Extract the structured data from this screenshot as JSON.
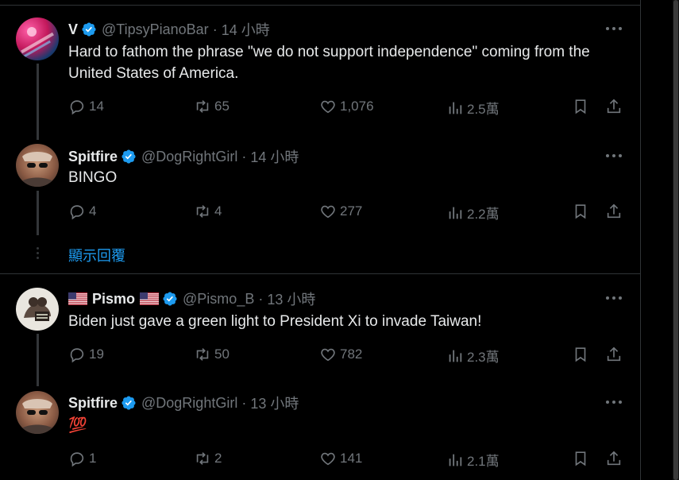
{
  "tweets": [
    {
      "name": "V",
      "handle": "@TipsyPianoBar",
      "time": "14 小時",
      "text": "Hard to fathom the phrase \"we do not support independence\" coming from the United States of America.",
      "replies": "14",
      "retweets": "65",
      "likes": "1,076",
      "views": "2.5萬"
    },
    {
      "name": "Spitfire",
      "handle": "@DogRightGirl",
      "time": "14 小時",
      "text": "BINGO",
      "replies": "4",
      "retweets": "4",
      "likes": "277",
      "views": "2.2萬"
    },
    {
      "name": "Pismo",
      "handle": "@Pismo_B",
      "time": "13 小時",
      "text": "Biden just gave a green light to President Xi to invade Taiwan!",
      "replies": "19",
      "retweets": "50",
      "likes": "782",
      "views": "2.3萬"
    },
    {
      "name": "Spitfire",
      "handle": "@DogRightGirl",
      "time": "13 小時",
      "text": "💯",
      "replies": "1",
      "retweets": "2",
      "likes": "141",
      "views": "2.1萬"
    }
  ],
  "show_replies_label": "顯示回覆",
  "colors": {
    "accent": "#1d9bf0",
    "muted": "#71767b",
    "text": "#e7e9ea",
    "bg": "#000000"
  }
}
